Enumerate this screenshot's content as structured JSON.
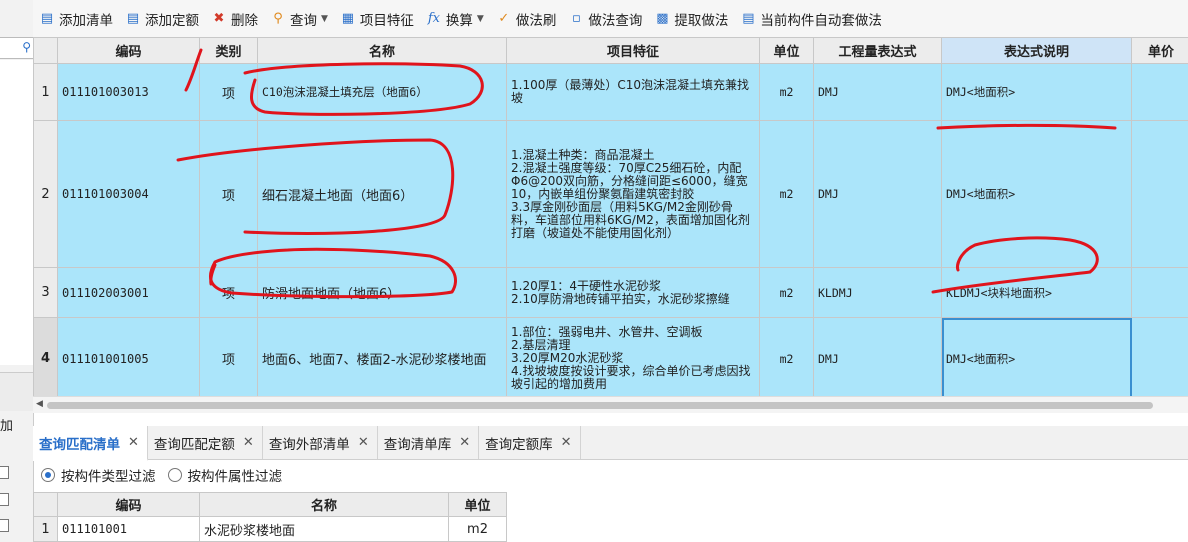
{
  "toolbar": {
    "items": [
      {
        "label": "添加清单",
        "icon": "add-list-icon",
        "color": "#2a6fc9"
      },
      {
        "label": "添加定额",
        "icon": "add-quota-icon",
        "color": "#2a6fc9"
      },
      {
        "label": "删除",
        "icon": "delete-icon",
        "color": "#d23a2a"
      },
      {
        "label": "查询",
        "icon": "query-icon",
        "color": "#e08a1e",
        "dropdown": true
      },
      {
        "label": "项目特征",
        "icon": "item-feature-icon",
        "color": "#2a6fc9"
      },
      {
        "label": "换算",
        "icon": "fx-icon",
        "color": "#2a6fc9",
        "dropdown": true
      },
      {
        "label": "做法刷",
        "icon": "brush-icon",
        "color": "#e08a1e"
      },
      {
        "label": "做法查询",
        "icon": "method-query-icon",
        "color": "#2a6fc9"
      },
      {
        "label": "提取做法",
        "icon": "extract-icon",
        "color": "#2a6fc9"
      },
      {
        "label": "当前构件自动套做法",
        "icon": "auto-apply-icon",
        "color": "#2a6fc9"
      }
    ]
  },
  "grid": {
    "headers": [
      "编码",
      "类别",
      "名称",
      "项目特征",
      "单位",
      "工程量表达式",
      "表达式说明",
      "单价"
    ],
    "rows": [
      {
        "num": "1",
        "code": "011101003013",
        "category": "项",
        "name": "C10泡沫混凝土填充层（地面6）",
        "feature": "1.100厚（最薄处）C10泡沫混凝土填充兼找坡",
        "unit": "m2",
        "expr": "DMJ",
        "desc": "DMJ<地面积>"
      },
      {
        "num": "2",
        "code": "011101003004",
        "category": "项",
        "name": "细石混凝土地面（地面6）",
        "feature": "1.混凝土种类：商品混凝土\n2.混凝土强度等级：70厚C25细石砼，内配Φ6@200双向筋，分格缝间距≤6000，缝宽10，内嵌单组份聚氨酯建筑密封胶\n3.3厚金刚砂面层（用料5KG/M2金刚砂骨料，车道部位用料6KG/M2，表面增加固化剂打磨（坡道处不能使用固化剂）",
        "unit": "m2",
        "expr": "DMJ",
        "desc": "DMJ<地面积>"
      },
      {
        "num": "3",
        "code": "011102003001",
        "category": "项",
        "name": "防滑地面地面（地面6）",
        "feature": "1.20厚1：4干硬性水泥砂浆\n2.10厚防滑地砖铺平拍实，水泥砂浆擦缝",
        "unit": "m2",
        "expr": "KLDMJ",
        "desc": "KLDMJ<块料地面积>"
      },
      {
        "num": "4",
        "code": "011101001005",
        "category": "项",
        "name": "地面6、地面7、楼面2-水泥砂浆楼地面",
        "feature": "1.部位：强弱电井、水管井、空调板\n2.基层清理\n3.20厚M20水泥砂浆\n4.找坡坡度按设计要求，综合单价已考虑因找坡引起的增加费用",
        "unit": "m2",
        "expr": "DMJ",
        "desc": "DMJ<地面积>"
      }
    ]
  },
  "bottom": {
    "tabs": [
      "查询匹配清单",
      "查询匹配定额",
      "查询外部清单",
      "查询清单库",
      "查询定额库"
    ],
    "filters": [
      "按构件类型过滤",
      "按构件属性过滤"
    ],
    "headers": [
      "编码",
      "名称",
      "单位"
    ],
    "rows": [
      {
        "num": "1",
        "code": "011101001",
        "name": "水泥砂浆楼地面",
        "unit": "m2"
      }
    ]
  },
  "left": {
    "add_label": "加"
  }
}
